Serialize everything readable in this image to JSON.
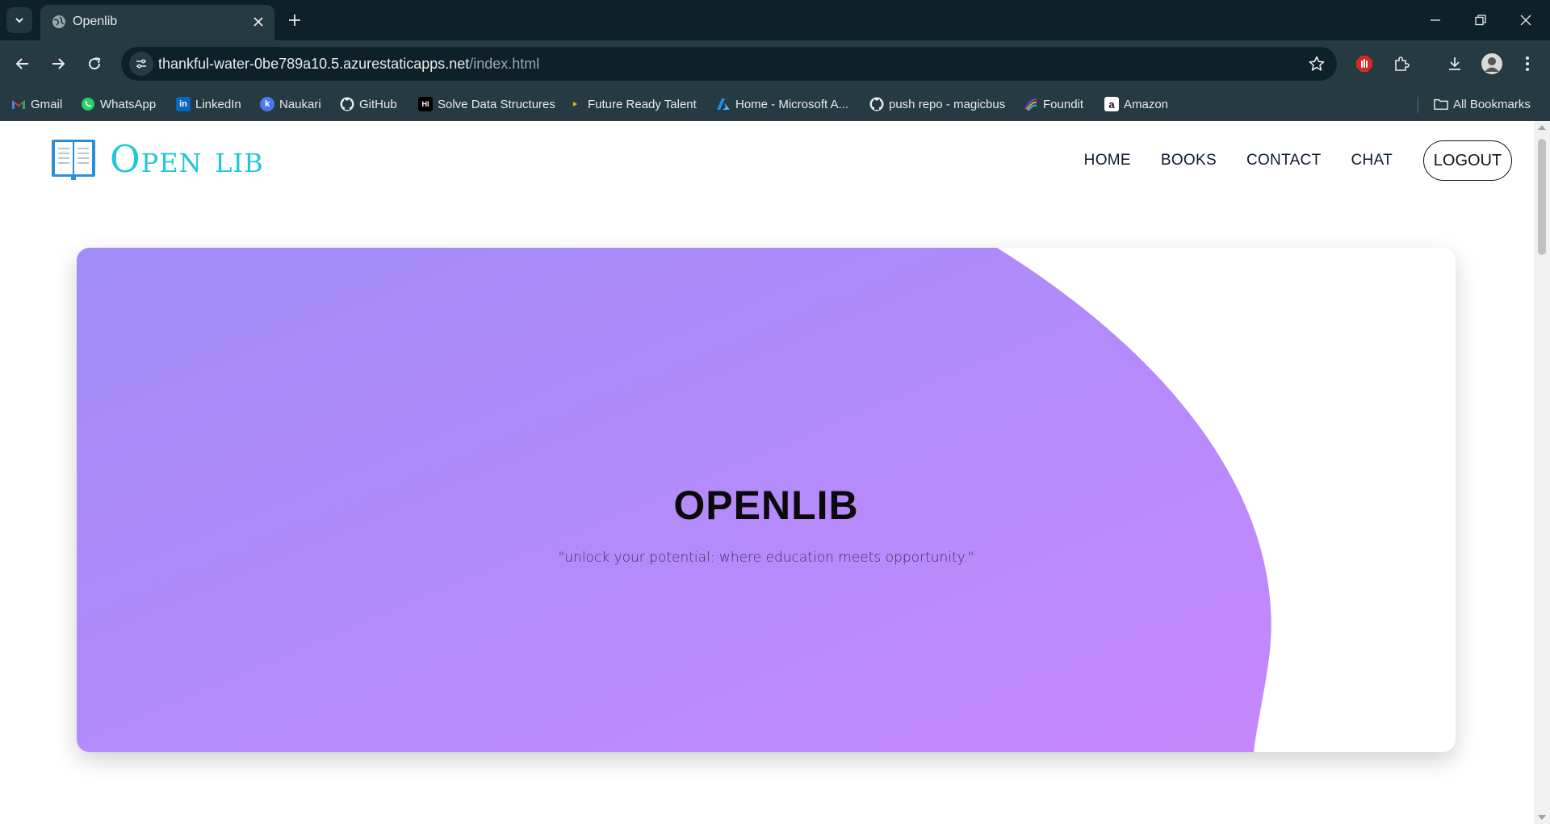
{
  "browser": {
    "tab_title": "Openlib",
    "url_host": "thankful-water-0be789a10.5.azurestaticapps.net",
    "url_path": "/index.html",
    "bookmarks": [
      {
        "label": "Gmail",
        "icon": "gmail-icon"
      },
      {
        "label": "WhatsApp",
        "icon": "whatsapp-icon"
      },
      {
        "label": "LinkedIn",
        "icon": "linkedin-icon"
      },
      {
        "label": "Naukari",
        "icon": "naukari-icon"
      },
      {
        "label": "GitHub",
        "icon": "github-icon"
      },
      {
        "label": "Solve Data Structures",
        "icon": "hackerrank-icon"
      },
      {
        "label": "Future Ready Talent",
        "icon": "play-icon"
      },
      {
        "label": "Home - Microsoft A...",
        "icon": "azure-icon"
      },
      {
        "label": "push repo - magicbus",
        "icon": "github-icon"
      },
      {
        "label": "Foundit",
        "icon": "foundit-icon"
      },
      {
        "label": "Amazon",
        "icon": "amazon-icon"
      }
    ],
    "all_bookmarks": "All Bookmarks"
  },
  "site": {
    "logo_text": "Open lib",
    "nav": [
      "HOME",
      "BOOKS",
      "CONTACT",
      "CHAT"
    ],
    "logout": "LOGOUT"
  },
  "hero": {
    "title": "OPENLIB",
    "subtitle": "\"unlock your potential: where education meets opportunity.\""
  },
  "colors": {
    "browser_frame": "#0f2128",
    "toolbar": "#263a41",
    "logo": "#1ec8d6",
    "hero_gradient_start": "#a18cf7",
    "hero_gradient_end": "#c588fb"
  }
}
